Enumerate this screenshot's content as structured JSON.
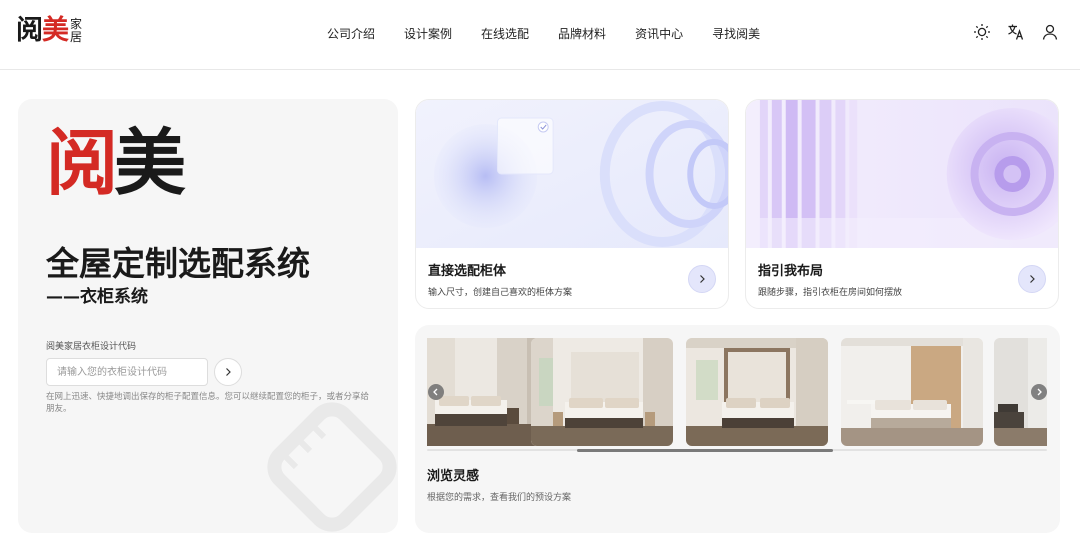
{
  "header": {
    "logo_main_a": "阅",
    "logo_main_b": "美",
    "logo_sub_top": "家",
    "logo_sub_bottom": "居",
    "nav": [
      "公司介绍",
      "设计案例",
      "在线选配",
      "品牌材料",
      "资讯中心",
      "寻找阅美"
    ],
    "icons": [
      "sun-icon",
      "translate-icon",
      "user-icon"
    ]
  },
  "hero": {
    "logo_a": "阅",
    "logo_b": "美",
    "title": "全屋定制选配系统",
    "subtitle": "——衣柜系统",
    "code_label": "阅美家居衣柜设计代码",
    "code_placeholder": "请输入您的衣柜设计代码",
    "code_value": "",
    "code_desc": "在网上迅速、快捷地调出保存的柜子配置信息。您可以继续配置您的柜子，或者分享给朋友。"
  },
  "cards": [
    {
      "title": "直接选配柜体",
      "desc": "输入尺寸，创建自己喜欢的柜体方案",
      "icon": "chevron-right-icon"
    },
    {
      "title": "指引我布局",
      "desc": "跟随步骤，指引衣柜在房间如何摆放",
      "icon": "chevron-right-icon"
    }
  ],
  "browse": {
    "title": "浏览灵感",
    "desc": "根据您的需求，查看我们的预设方案",
    "thumb_count": 5
  },
  "colors": {
    "brand_red": "#d42a24",
    "accent_lavender": "#e4e6fb",
    "card_bg": "#f6f6f6"
  }
}
